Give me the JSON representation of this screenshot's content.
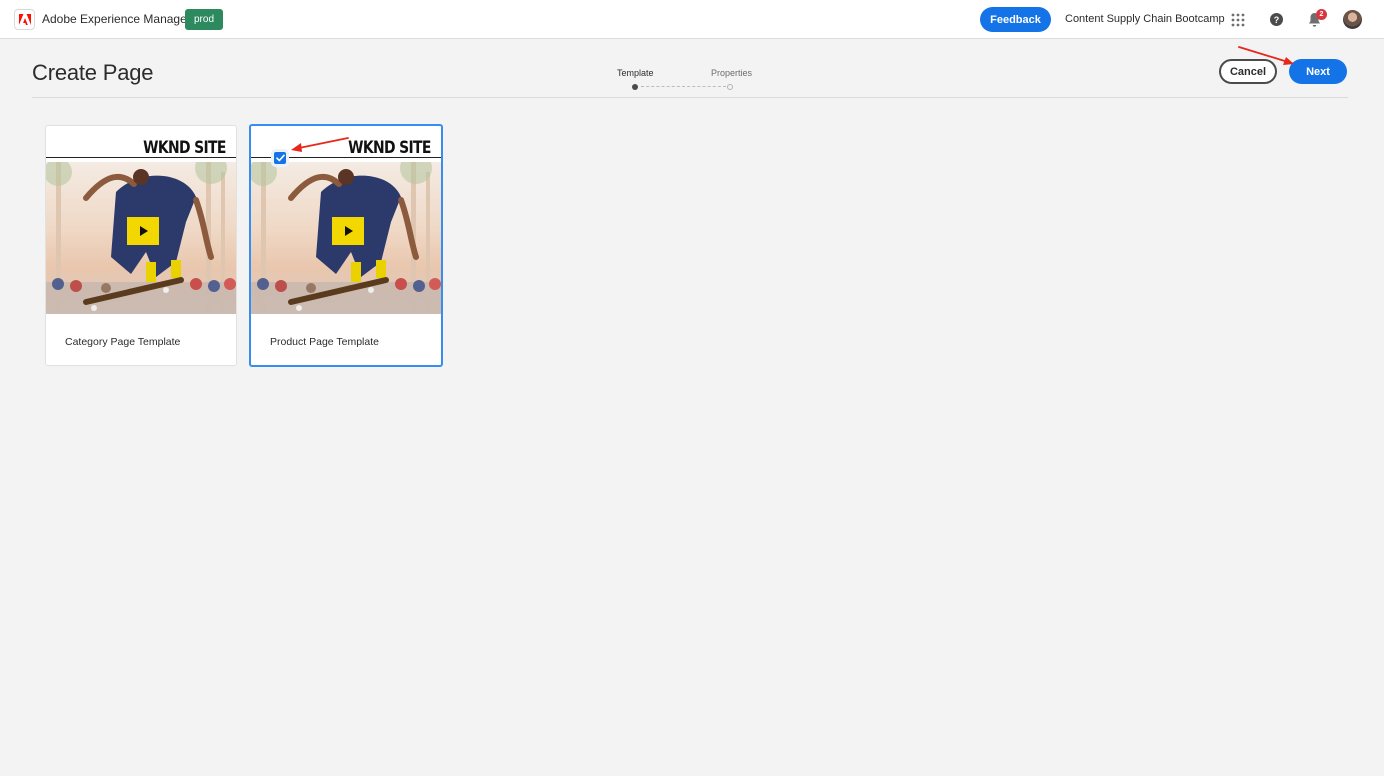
{
  "shell": {
    "app_name": "Adobe Experience Manager",
    "environment_badge": "prod",
    "feedback_label": "Feedback",
    "org_name": "Content Supply Chain Bootcamp",
    "help_glyph": "?",
    "notification_count": "2",
    "icons": {
      "logo": "adobe-logo-icon",
      "apps": "apps-grid-icon",
      "help": "help-icon",
      "notifications": "bell-icon",
      "avatar": "user-avatar"
    },
    "brand_color": "#fa0f00",
    "accent_color": "#1473e6",
    "env_color": "#2d8a5f"
  },
  "page": {
    "title": "Create Page",
    "wizard": {
      "steps": [
        {
          "label": "Template",
          "active": true
        },
        {
          "label": "Properties",
          "active": false
        }
      ]
    },
    "actions": {
      "cancel_label": "Cancel",
      "next_label": "Next"
    }
  },
  "templates": [
    {
      "label": "Category Page Template",
      "brand": "WKND SITE",
      "selected": false
    },
    {
      "label": "Product Page Template",
      "brand": "WKND SITE",
      "selected": true
    }
  ]
}
